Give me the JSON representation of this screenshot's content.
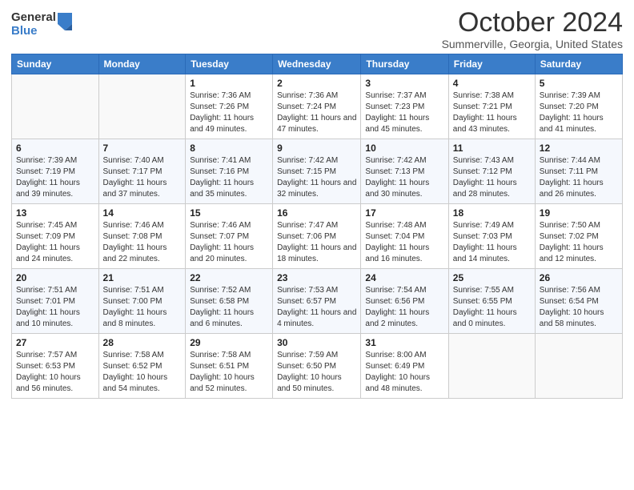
{
  "header": {
    "logo_general": "General",
    "logo_blue": "Blue",
    "title": "October 2024",
    "location": "Summerville, Georgia, United States"
  },
  "days_of_week": [
    "Sunday",
    "Monday",
    "Tuesday",
    "Wednesday",
    "Thursday",
    "Friday",
    "Saturday"
  ],
  "weeks": [
    [
      null,
      null,
      {
        "day": 1,
        "sunrise": "7:36 AM",
        "sunset": "7:26 PM",
        "daylight": "11 hours and 49 minutes."
      },
      {
        "day": 2,
        "sunrise": "7:36 AM",
        "sunset": "7:24 PM",
        "daylight": "11 hours and 47 minutes."
      },
      {
        "day": 3,
        "sunrise": "7:37 AM",
        "sunset": "7:23 PM",
        "daylight": "11 hours and 45 minutes."
      },
      {
        "day": 4,
        "sunrise": "7:38 AM",
        "sunset": "7:21 PM",
        "daylight": "11 hours and 43 minutes."
      },
      {
        "day": 5,
        "sunrise": "7:39 AM",
        "sunset": "7:20 PM",
        "daylight": "11 hours and 41 minutes."
      }
    ],
    [
      {
        "day": 6,
        "sunrise": "7:39 AM",
        "sunset": "7:19 PM",
        "daylight": "11 hours and 39 minutes."
      },
      {
        "day": 7,
        "sunrise": "7:40 AM",
        "sunset": "7:17 PM",
        "daylight": "11 hours and 37 minutes."
      },
      {
        "day": 8,
        "sunrise": "7:41 AM",
        "sunset": "7:16 PM",
        "daylight": "11 hours and 35 minutes."
      },
      {
        "day": 9,
        "sunrise": "7:42 AM",
        "sunset": "7:15 PM",
        "daylight": "11 hours and 32 minutes."
      },
      {
        "day": 10,
        "sunrise": "7:42 AM",
        "sunset": "7:13 PM",
        "daylight": "11 hours and 30 minutes."
      },
      {
        "day": 11,
        "sunrise": "7:43 AM",
        "sunset": "7:12 PM",
        "daylight": "11 hours and 28 minutes."
      },
      {
        "day": 12,
        "sunrise": "7:44 AM",
        "sunset": "7:11 PM",
        "daylight": "11 hours and 26 minutes."
      }
    ],
    [
      {
        "day": 13,
        "sunrise": "7:45 AM",
        "sunset": "7:09 PM",
        "daylight": "11 hours and 24 minutes."
      },
      {
        "day": 14,
        "sunrise": "7:46 AM",
        "sunset": "7:08 PM",
        "daylight": "11 hours and 22 minutes."
      },
      {
        "day": 15,
        "sunrise": "7:46 AM",
        "sunset": "7:07 PM",
        "daylight": "11 hours and 20 minutes."
      },
      {
        "day": 16,
        "sunrise": "7:47 AM",
        "sunset": "7:06 PM",
        "daylight": "11 hours and 18 minutes."
      },
      {
        "day": 17,
        "sunrise": "7:48 AM",
        "sunset": "7:04 PM",
        "daylight": "11 hours and 16 minutes."
      },
      {
        "day": 18,
        "sunrise": "7:49 AM",
        "sunset": "7:03 PM",
        "daylight": "11 hours and 14 minutes."
      },
      {
        "day": 19,
        "sunrise": "7:50 AM",
        "sunset": "7:02 PM",
        "daylight": "11 hours and 12 minutes."
      }
    ],
    [
      {
        "day": 20,
        "sunrise": "7:51 AM",
        "sunset": "7:01 PM",
        "daylight": "11 hours and 10 minutes."
      },
      {
        "day": 21,
        "sunrise": "7:51 AM",
        "sunset": "7:00 PM",
        "daylight": "11 hours and 8 minutes."
      },
      {
        "day": 22,
        "sunrise": "7:52 AM",
        "sunset": "6:58 PM",
        "daylight": "11 hours and 6 minutes."
      },
      {
        "day": 23,
        "sunrise": "7:53 AM",
        "sunset": "6:57 PM",
        "daylight": "11 hours and 4 minutes."
      },
      {
        "day": 24,
        "sunrise": "7:54 AM",
        "sunset": "6:56 PM",
        "daylight": "11 hours and 2 minutes."
      },
      {
        "day": 25,
        "sunrise": "7:55 AM",
        "sunset": "6:55 PM",
        "daylight": "11 hours and 0 minutes."
      },
      {
        "day": 26,
        "sunrise": "7:56 AM",
        "sunset": "6:54 PM",
        "daylight": "10 hours and 58 minutes."
      }
    ],
    [
      {
        "day": 27,
        "sunrise": "7:57 AM",
        "sunset": "6:53 PM",
        "daylight": "10 hours and 56 minutes."
      },
      {
        "day": 28,
        "sunrise": "7:58 AM",
        "sunset": "6:52 PM",
        "daylight": "10 hours and 54 minutes."
      },
      {
        "day": 29,
        "sunrise": "7:58 AM",
        "sunset": "6:51 PM",
        "daylight": "10 hours and 52 minutes."
      },
      {
        "day": 30,
        "sunrise": "7:59 AM",
        "sunset": "6:50 PM",
        "daylight": "10 hours and 50 minutes."
      },
      {
        "day": 31,
        "sunrise": "8:00 AM",
        "sunset": "6:49 PM",
        "daylight": "10 hours and 48 minutes."
      },
      null,
      null
    ]
  ]
}
